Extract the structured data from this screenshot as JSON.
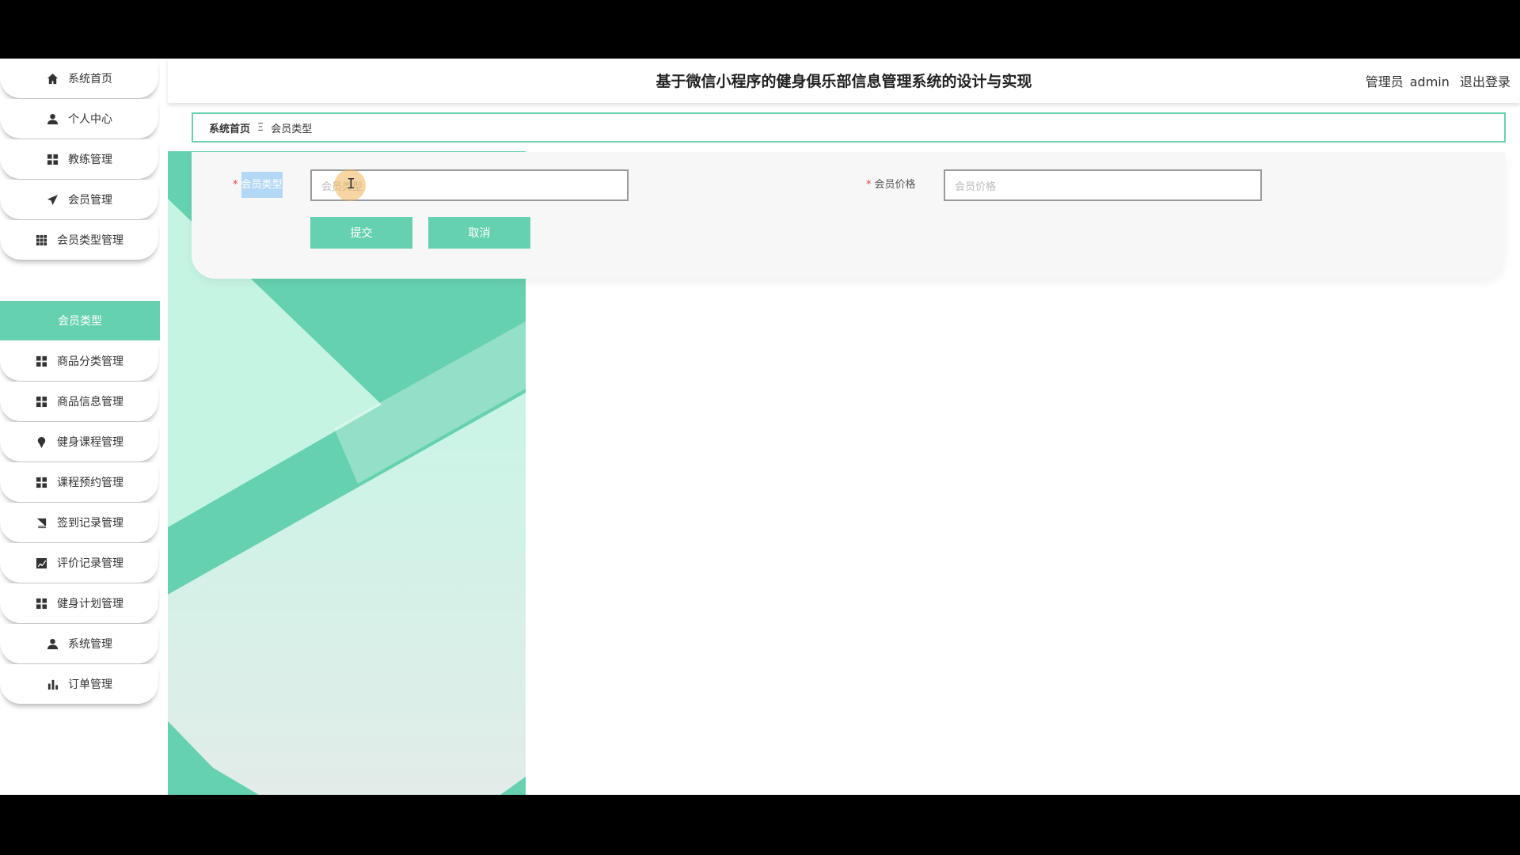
{
  "header": {
    "title": "基于微信小程序的健身俱乐部信息管理系统的设计与实现",
    "user_role": "管理员",
    "username": "admin",
    "logout": "退出登录"
  },
  "sidebar": {
    "items": [
      {
        "label": "系统首页",
        "icon": "home-icon"
      },
      {
        "label": "个人中心",
        "icon": "user-icon"
      },
      {
        "label": "教练管理",
        "icon": "grid-icon"
      },
      {
        "label": "会员管理",
        "icon": "send-icon"
      },
      {
        "label": "会员类型管理",
        "icon": "grid9-icon"
      },
      {
        "label": "商品分类管理",
        "icon": "grid-icon"
      },
      {
        "label": "商品信息管理",
        "icon": "grid-icon"
      },
      {
        "label": "健身课程管理",
        "icon": "pin-icon"
      },
      {
        "label": "课程预约管理",
        "icon": "grid-icon"
      },
      {
        "label": "签到记录管理",
        "icon": "book-icon"
      },
      {
        "label": "评价记录管理",
        "icon": "chart-line-icon"
      },
      {
        "label": "健身计划管理",
        "icon": "grid-icon"
      },
      {
        "label": "系统管理",
        "icon": "admin-user-icon"
      },
      {
        "label": "订单管理",
        "icon": "bar-chart-icon"
      }
    ],
    "active_sub": "会员类型"
  },
  "breadcrumb": {
    "home": "系统首页",
    "separator": "Ξ",
    "current": "会员类型"
  },
  "form": {
    "fields": {
      "type": {
        "label": "会员类型",
        "placeholder": "会员类型",
        "required_mark": "*"
      },
      "price": {
        "label": "会员价格",
        "placeholder": "会员价格",
        "required_mark": "*"
      }
    },
    "submit": "提交",
    "cancel": "取消"
  },
  "colors": {
    "accent": "#66d1b0",
    "accent_dark": "#4fc39c",
    "header_bg": "#ffffff"
  }
}
